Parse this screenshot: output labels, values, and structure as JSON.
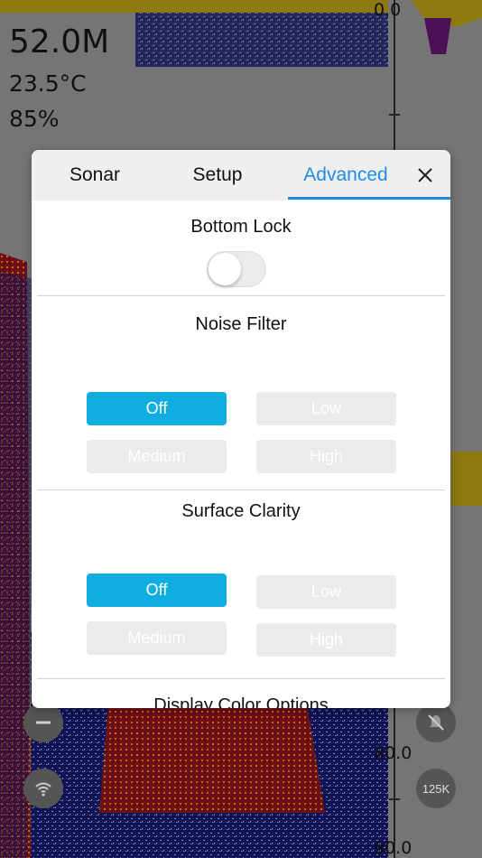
{
  "readouts": {
    "depth": "52.0M",
    "temperature": "23.5°C",
    "gain": "85%"
  },
  "scale": {
    "top_label": "0.0",
    "mid_label": "80.0",
    "bottom_label": "90.0"
  },
  "side_buttons": {
    "frequency": "125K"
  },
  "dialog": {
    "tabs": [
      "Sonar",
      "Setup",
      "Advanced"
    ],
    "active_tab": "Advanced",
    "bottom_lock": {
      "title": "Bottom Lock",
      "on": false
    },
    "noise_filter": {
      "title": "Noise Filter",
      "options": [
        "Off",
        "Low",
        "Medium",
        "High"
      ],
      "selected": "Off"
    },
    "surface_clarity": {
      "title": "Surface Clarity",
      "options": [
        "Off",
        "Low",
        "Medium",
        "High"
      ],
      "selected": "Off"
    },
    "next_section": "Display Color Options"
  },
  "colors": {
    "accent": "#1f8cea",
    "selected_option": "#10aee0",
    "unselected_option": "#ebebee"
  }
}
